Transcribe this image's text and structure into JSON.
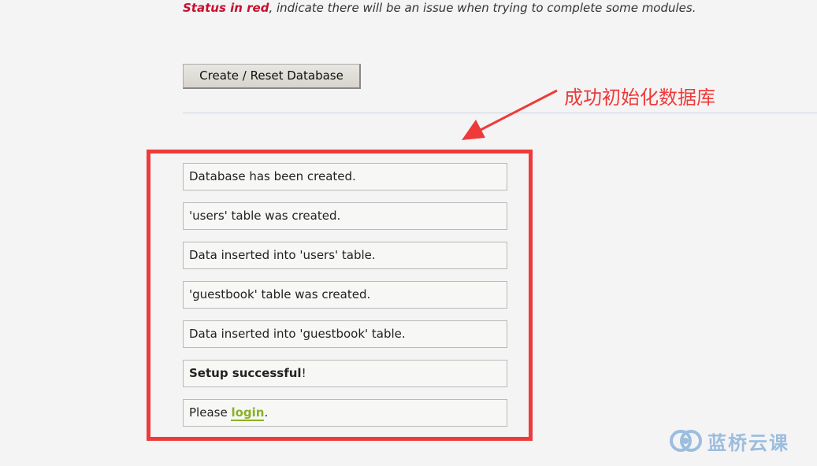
{
  "intro": {
    "status_red": "Status in red",
    "status_rest": ", indicate there will be an issue when trying to complete some modules."
  },
  "create_button": {
    "label": "Create / Reset Database"
  },
  "messages": {
    "items": [
      "Database has been created.",
      "'users' table was created.",
      "Data inserted into 'users' table.",
      "'guestbook' table was created.",
      "Data inserted into 'guestbook' table."
    ],
    "setup_bold": "Setup successful",
    "setup_suffix": "!",
    "login_prefix": "Please ",
    "login_link": "login",
    "login_suffix": "."
  },
  "annotation": {
    "text": "成功初始化数据库",
    "color": "#ee3a3a"
  },
  "watermark": {
    "text": "蓝桥云课",
    "icon": "lanqiao-logo-icon",
    "color": "#9bbde0"
  },
  "colors": {
    "highlight_border": "#ee3a3a",
    "status_red": "#c8102e",
    "link_green": "#8bb023"
  }
}
